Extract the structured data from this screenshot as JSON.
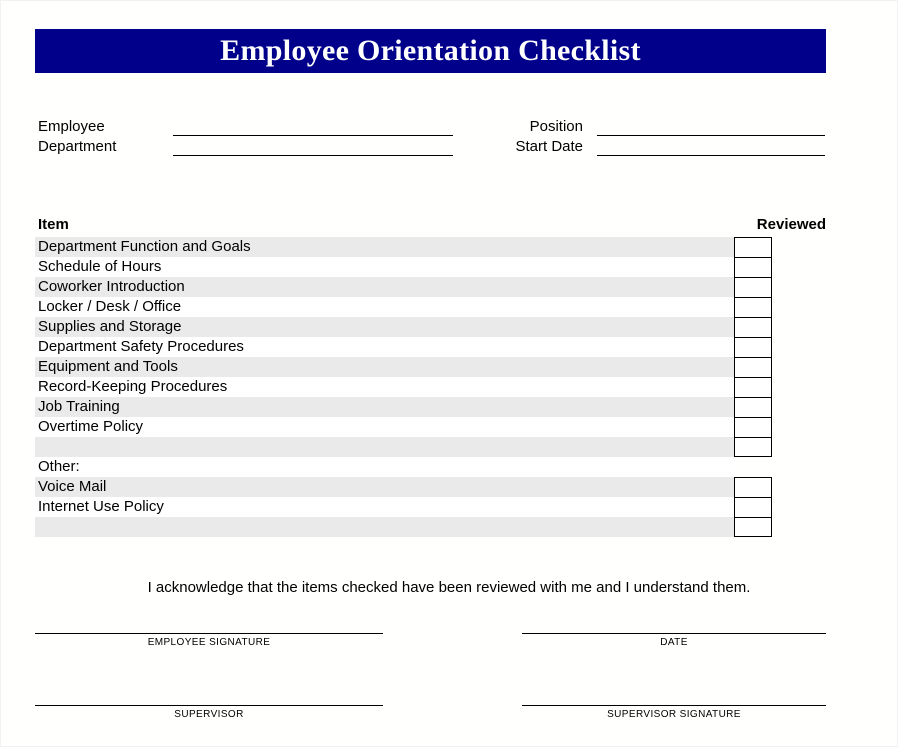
{
  "document": {
    "title": "Employee Orientation Checklist",
    "banner_color": "#00008b",
    "banner_text_color": "#ffffff",
    "row_shade_color": "#eaeaea"
  },
  "header_fields": {
    "left": [
      {
        "label": "Employee",
        "value": ""
      },
      {
        "label": "Department",
        "value": ""
      }
    ],
    "right": [
      {
        "label": "Position",
        "value": ""
      },
      {
        "label": "Start Date",
        "value": ""
      }
    ]
  },
  "checklist": {
    "columns": {
      "item": "Item",
      "reviewed": "Reviewed"
    },
    "group_one": [
      {
        "label": "Department Function and Goals",
        "shaded": true,
        "checkbox": true,
        "checked": false
      },
      {
        "label": "Schedule of Hours",
        "shaded": false,
        "checkbox": true,
        "checked": false
      },
      {
        "label": "Coworker Introduction",
        "shaded": true,
        "checkbox": true,
        "checked": false
      },
      {
        "label": "Locker / Desk / Office",
        "shaded": false,
        "checkbox": true,
        "checked": false
      },
      {
        "label": "Supplies and Storage",
        "shaded": true,
        "checkbox": true,
        "checked": false
      },
      {
        "label": "Department Safety Procedures",
        "shaded": false,
        "checkbox": true,
        "checked": false
      },
      {
        "label": "Equipment and Tools",
        "shaded": true,
        "checkbox": true,
        "checked": false
      },
      {
        "label": "Record-Keeping Procedures",
        "shaded": false,
        "checkbox": true,
        "checked": false
      },
      {
        "label": "Job Training",
        "shaded": true,
        "checkbox": true,
        "checked": false
      },
      {
        "label": "Overtime Policy",
        "shaded": false,
        "checkbox": true,
        "checked": false
      },
      {
        "label": "",
        "shaded": true,
        "checkbox": true,
        "checked": false
      }
    ],
    "group_two": [
      {
        "label": "Other:",
        "shaded": false,
        "checkbox": false,
        "checked": false
      },
      {
        "label": "Voice Mail",
        "shaded": true,
        "checkbox": true,
        "checked": false
      },
      {
        "label": "Internet Use Policy",
        "shaded": false,
        "checkbox": true,
        "checked": false
      },
      {
        "label": "",
        "shaded": true,
        "checkbox": true,
        "checked": false
      }
    ]
  },
  "acknowledgment": "I acknowledge that the items checked have been reviewed with me and I understand them.",
  "signatures": [
    {
      "caption": "EMPLOYEE SIGNATURE"
    },
    {
      "caption": "DATE"
    },
    {
      "caption": "SUPERVISOR"
    },
    {
      "caption": "SUPERVISOR SIGNATURE"
    }
  ]
}
